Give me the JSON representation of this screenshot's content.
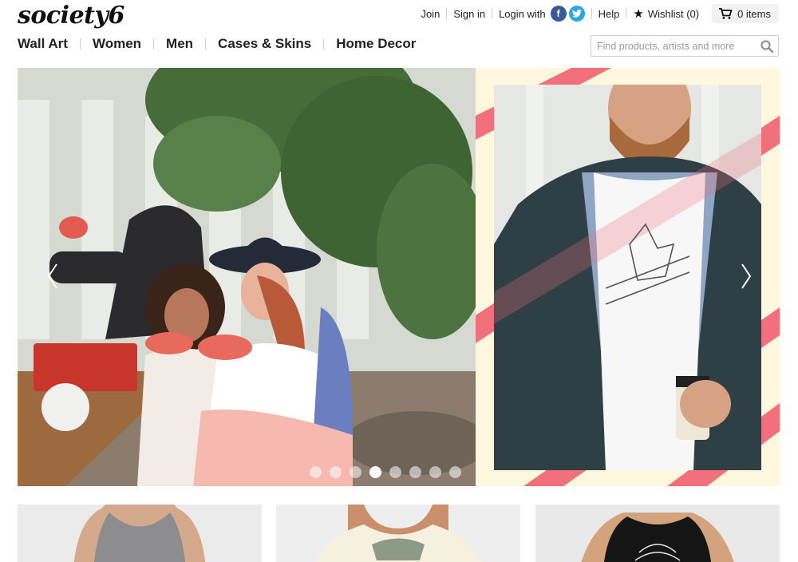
{
  "brand": {
    "logo_text": "society6"
  },
  "topbar": {
    "join": "Join",
    "sign_in": "Sign in",
    "login_with": "Login with",
    "help": "Help",
    "wishlist": "Wishlist (0)",
    "cart": "0 items"
  },
  "nav": {
    "items": [
      "Wall Art",
      "Women",
      "Men",
      "Cases & Skins",
      "Home Decor"
    ]
  },
  "search": {
    "placeholder": "Find products, artists and more"
  },
  "carousel": {
    "slide_count": 8,
    "active_index": 3
  },
  "icons": {
    "facebook": "facebook-icon",
    "twitter": "twitter-icon",
    "star": "star-icon",
    "cart": "cart-icon",
    "search": "search-icon",
    "prev": "chevron-left-icon",
    "next": "chevron-right-icon"
  },
  "colors": {
    "facebook": "#3b5a9a",
    "twitter": "#2ca7e0",
    "stripe": "#f2707c",
    "panel": "#fff8df"
  }
}
